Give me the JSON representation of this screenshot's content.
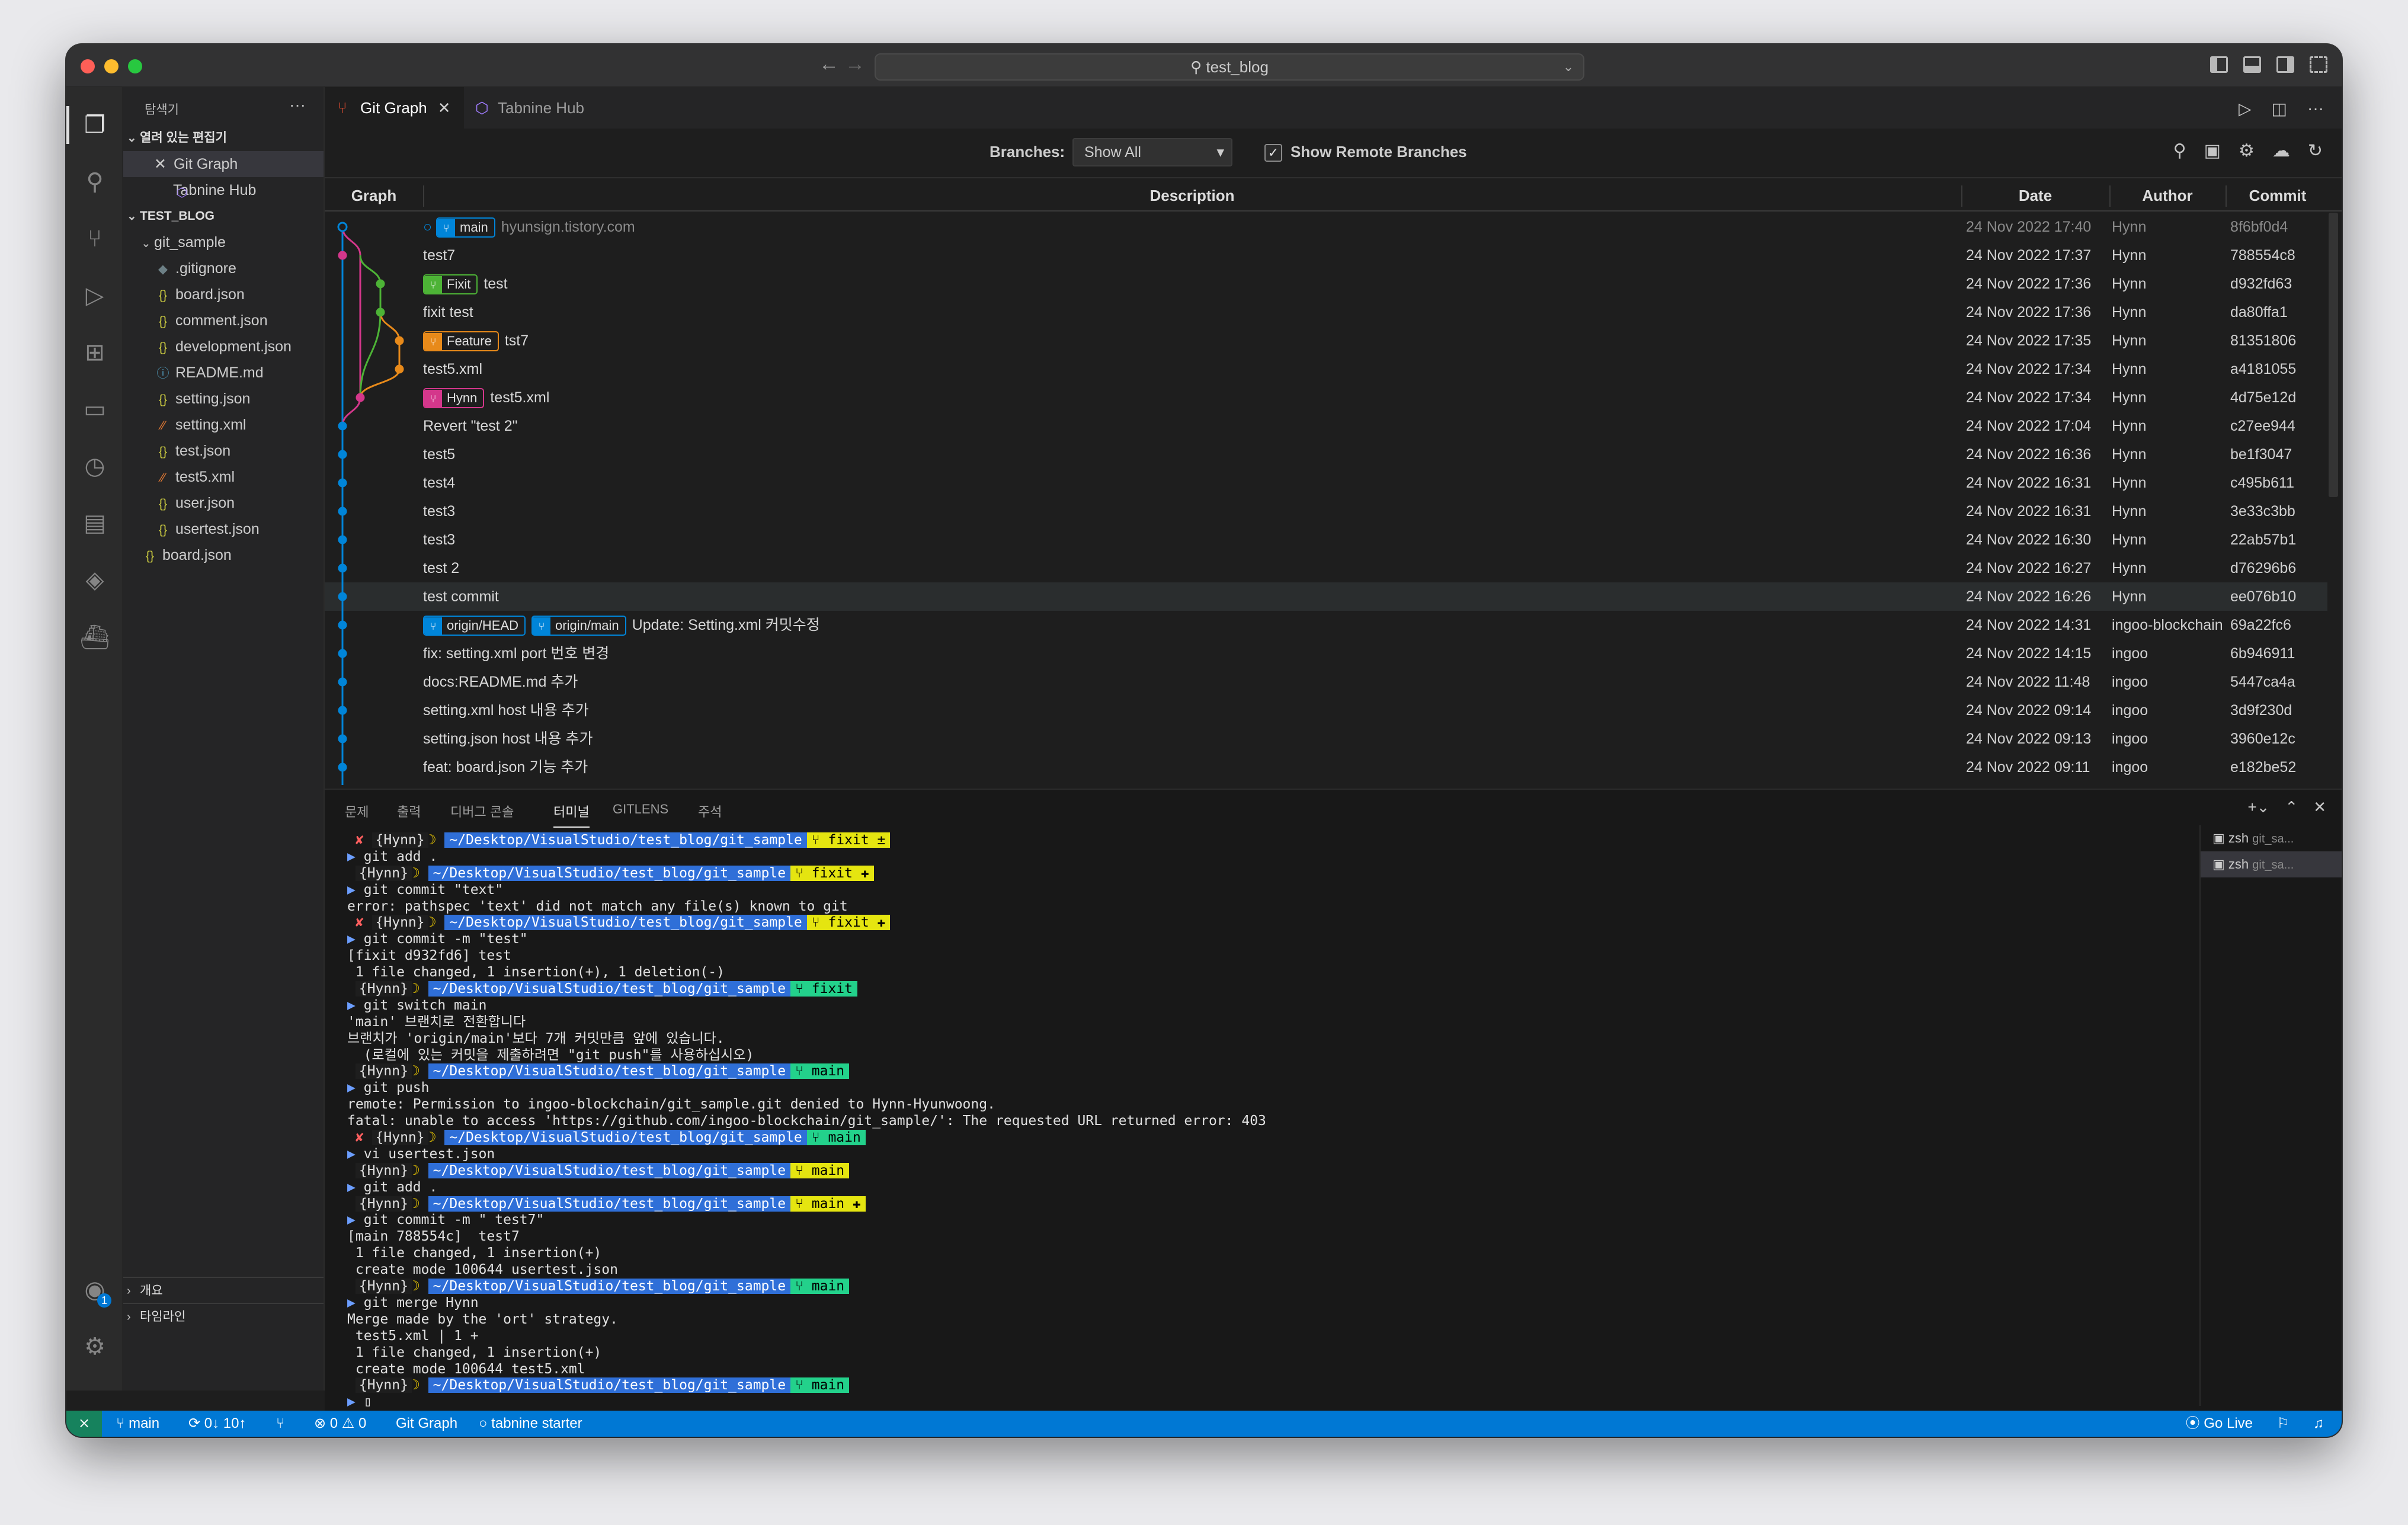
{
  "titlebar": {
    "search_text": "test_blog"
  },
  "sidebar": {
    "title": "탐색기",
    "open_editors_label": "열려 있는 편집기",
    "open_editors": [
      "Git Graph",
      "Tabnine Hub"
    ],
    "workspace_label": "TEST_BLOG",
    "folder": "git_sample",
    "files": [
      {
        "name": ".gitignore",
        "icon": "git-icon"
      },
      {
        "name": "board.json",
        "icon": "json-icon"
      },
      {
        "name": "comment.json",
        "icon": "json-icon"
      },
      {
        "name": "development.json",
        "icon": "json-icon"
      },
      {
        "name": "README.md",
        "icon": "info-icon"
      },
      {
        "name": "setting.json",
        "icon": "json-icon"
      },
      {
        "name": "setting.xml",
        "icon": "xml-icon"
      },
      {
        "name": "test.json",
        "icon": "json-icon"
      },
      {
        "name": "test5.xml",
        "icon": "xml-icon"
      },
      {
        "name": "user.json",
        "icon": "json-icon"
      },
      {
        "name": "usertest.json",
        "icon": "json-icon"
      }
    ],
    "root_file": "board.json",
    "outline_label": "개요",
    "timeline_label": "타임라인"
  },
  "tabs": [
    {
      "label": "Git Graph",
      "active": true
    },
    {
      "label": "Tabnine Hub",
      "active": false
    }
  ],
  "gitgraph": {
    "branches_label": "Branches:",
    "branches_value": "Show All",
    "show_remote_label": "Show Remote Branches",
    "show_remote_checked": true,
    "columns": [
      "Graph",
      "Description",
      "Date",
      "Author",
      "Commit"
    ],
    "rows": [
      {
        "refs": [
          {
            "name": "main",
            "color": "#0085d9"
          }
        ],
        "message": "hyunsign.tistory.com",
        "date": "24 Nov 2022 17:40",
        "author": "Hynn",
        "hash": "8f6bf0d4",
        "dim": true
      },
      {
        "refs": [],
        "message": "test7",
        "date": "24 Nov 2022 17:37",
        "author": "Hynn",
        "hash": "788554c8"
      },
      {
        "refs": [
          {
            "name": "Fixit",
            "color": "#4db336"
          }
        ],
        "message": "test",
        "date": "24 Nov 2022 17:36",
        "author": "Hynn",
        "hash": "d932fd63"
      },
      {
        "refs": [],
        "message": "fixit test",
        "date": "24 Nov 2022 17:36",
        "author": "Hynn",
        "hash": "da80ffa1"
      },
      {
        "refs": [
          {
            "name": "Feature",
            "color": "#e88a1a"
          }
        ],
        "message": "tst7",
        "date": "24 Nov 2022 17:35",
        "author": "Hynn",
        "hash": "81351806"
      },
      {
        "refs": [],
        "message": "test5.xml",
        "date": "24 Nov 2022 17:34",
        "author": "Hynn",
        "hash": "a4181055"
      },
      {
        "refs": [
          {
            "name": "Hynn",
            "color": "#d4378b"
          }
        ],
        "message": "test5.xml",
        "date": "24 Nov 2022 17:34",
        "author": "Hynn",
        "hash": "4d75e12d"
      },
      {
        "refs": [],
        "message": "Revert \"test 2\"",
        "date": "24 Nov 2022 17:04",
        "author": "Hynn",
        "hash": "c27ee944"
      },
      {
        "refs": [],
        "message": "test5",
        "date": "24 Nov 2022 16:36",
        "author": "Hynn",
        "hash": "be1f3047"
      },
      {
        "refs": [],
        "message": "test4",
        "date": "24 Nov 2022 16:31",
        "author": "Hynn",
        "hash": "c495b611"
      },
      {
        "refs": [],
        "message": "test3",
        "date": "24 Nov 2022 16:31",
        "author": "Hynn",
        "hash": "3e33c3bb"
      },
      {
        "refs": [],
        "message": "test3",
        "date": "24 Nov 2022 16:30",
        "author": "Hynn",
        "hash": "22ab57b1"
      },
      {
        "refs": [],
        "message": "test 2",
        "date": "24 Nov 2022 16:27",
        "author": "Hynn",
        "hash": "d76296b6"
      },
      {
        "refs": [],
        "message": "test commit",
        "date": "24 Nov 2022 16:26",
        "author": "Hynn",
        "hash": "ee076b10",
        "highlight": true
      },
      {
        "refs": [
          {
            "name": "origin/HEAD",
            "color": "#0085d9"
          },
          {
            "name": "origin/main",
            "color": "#0085d9"
          }
        ],
        "message": "Update: Setting.xml 커밋수정",
        "date": "24 Nov 2022 14:31",
        "author": "ingoo-blockchain",
        "hash": "69a22fc6"
      },
      {
        "refs": [],
        "message": "fix: setting.xml port 번호 변경",
        "date": "24 Nov 2022 14:15",
        "author": "ingoo",
        "hash": "6b946911"
      },
      {
        "refs": [],
        "message": "docs:README.md 추가",
        "date": "24 Nov 2022 11:48",
        "author": "ingoo",
        "hash": "5447ca4a"
      },
      {
        "refs": [],
        "message": "setting.xml host 내용 추가",
        "date": "24 Nov 2022 09:14",
        "author": "ingoo",
        "hash": "3d9f230d"
      },
      {
        "refs": [],
        "message": "setting.json host 내용 추가",
        "date": "24 Nov 2022 09:13",
        "author": "ingoo",
        "hash": "3960e12c"
      },
      {
        "refs": [],
        "message": "feat: board.json 기능 추가",
        "date": "24 Nov 2022 09:11",
        "author": "ingoo",
        "hash": "e182be52"
      }
    ]
  },
  "panel": {
    "tabs": [
      "문제",
      "출력",
      "디버그 콘솔",
      "터미널",
      "GITLENS",
      "주석"
    ],
    "active_tab": "터미널",
    "terminals": [
      {
        "label": "zsh",
        "sub": "git_sa..."
      },
      {
        "label": "zsh",
        "sub": "git_sa..."
      }
    ],
    "user": "{Hynn}",
    "path": "~/Desktop/VisualStudio/test_blog/git_sample",
    "lines": [
      {
        "type": "prompt",
        "x": true,
        "branch": "fixit ±",
        "color": "yellow"
      },
      {
        "type": "cmd",
        "text": "git add ."
      },
      {
        "type": "prompt",
        "x": false,
        "branch": "fixit ✚",
        "color": "yellow"
      },
      {
        "type": "cmd",
        "text": "git commit \"text\""
      },
      {
        "type": "out",
        "text": "error: pathspec 'text' did not match any file(s) known to git"
      },
      {
        "type": "prompt",
        "x": true,
        "branch": "fixit ✚",
        "color": "yellow"
      },
      {
        "type": "cmd",
        "text": "git commit -m \"test\""
      },
      {
        "type": "out",
        "text": "[fixit d932fd6] test"
      },
      {
        "type": "out",
        "text": " 1 file changed, 1 insertion(+), 1 deletion(-)"
      },
      {
        "type": "prompt",
        "x": false,
        "branch": "fixit",
        "color": "green"
      },
      {
        "type": "cmd",
        "text": "git switch main"
      },
      {
        "type": "out",
        "text": "'main' 브랜치로 전환합니다"
      },
      {
        "type": "out",
        "text": "브랜치가 'origin/main'보다 7개 커밋만큼 앞에 있습니다."
      },
      {
        "type": "out",
        "text": "  (로컬에 있는 커밋을 제출하려면 \"git push\"를 사용하십시오)"
      },
      {
        "type": "prompt",
        "x": false,
        "branch": "main",
        "color": "green"
      },
      {
        "type": "cmd",
        "text": "git push"
      },
      {
        "type": "out",
        "text": "remote: Permission to ingoo-blockchain/git_sample.git denied to Hynn-Hyunwoong."
      },
      {
        "type": "out",
        "text": "fatal: unable to access 'https://github.com/ingoo-blockchain/git_sample/': The requested URL returned error: 403"
      },
      {
        "type": "prompt",
        "x": true,
        "branch": "main",
        "color": "green"
      },
      {
        "type": "cmd",
        "text": "vi usertest.json"
      },
      {
        "type": "prompt",
        "x": false,
        "branch": "main",
        "color": "yellow"
      },
      {
        "type": "cmd",
        "text": "git add ."
      },
      {
        "type": "prompt",
        "x": false,
        "branch": "main ✚",
        "color": "yellow"
      },
      {
        "type": "cmd",
        "text": "git commit -m \" test7\""
      },
      {
        "type": "out",
        "text": "[main 788554c]  test7"
      },
      {
        "type": "out",
        "text": " 1 file changed, 1 insertion(+)"
      },
      {
        "type": "out",
        "text": " create mode 100644 usertest.json"
      },
      {
        "type": "prompt",
        "x": false,
        "branch": "main",
        "color": "green"
      },
      {
        "type": "cmd",
        "text": "git merge Hynn"
      },
      {
        "type": "out",
        "text": "Merge made by the 'ort' strategy."
      },
      {
        "type": "out",
        "text": " test5.xml | 1 +"
      },
      {
        "type": "out",
        "text": " 1 file changed, 1 insertion(+)"
      },
      {
        "type": "out",
        "text": " create mode 100644 test5.xml"
      },
      {
        "type": "prompt",
        "x": false,
        "branch": "main",
        "color": "green"
      },
      {
        "type": "cmd",
        "text": ""
      }
    ]
  },
  "status": {
    "branch": "main",
    "sync": "0↓ 10↑",
    "problems": "0",
    "warnings": "0",
    "gitgraph": "Git Graph",
    "tabnine": "tabnine starter",
    "golive": "Go Live"
  }
}
